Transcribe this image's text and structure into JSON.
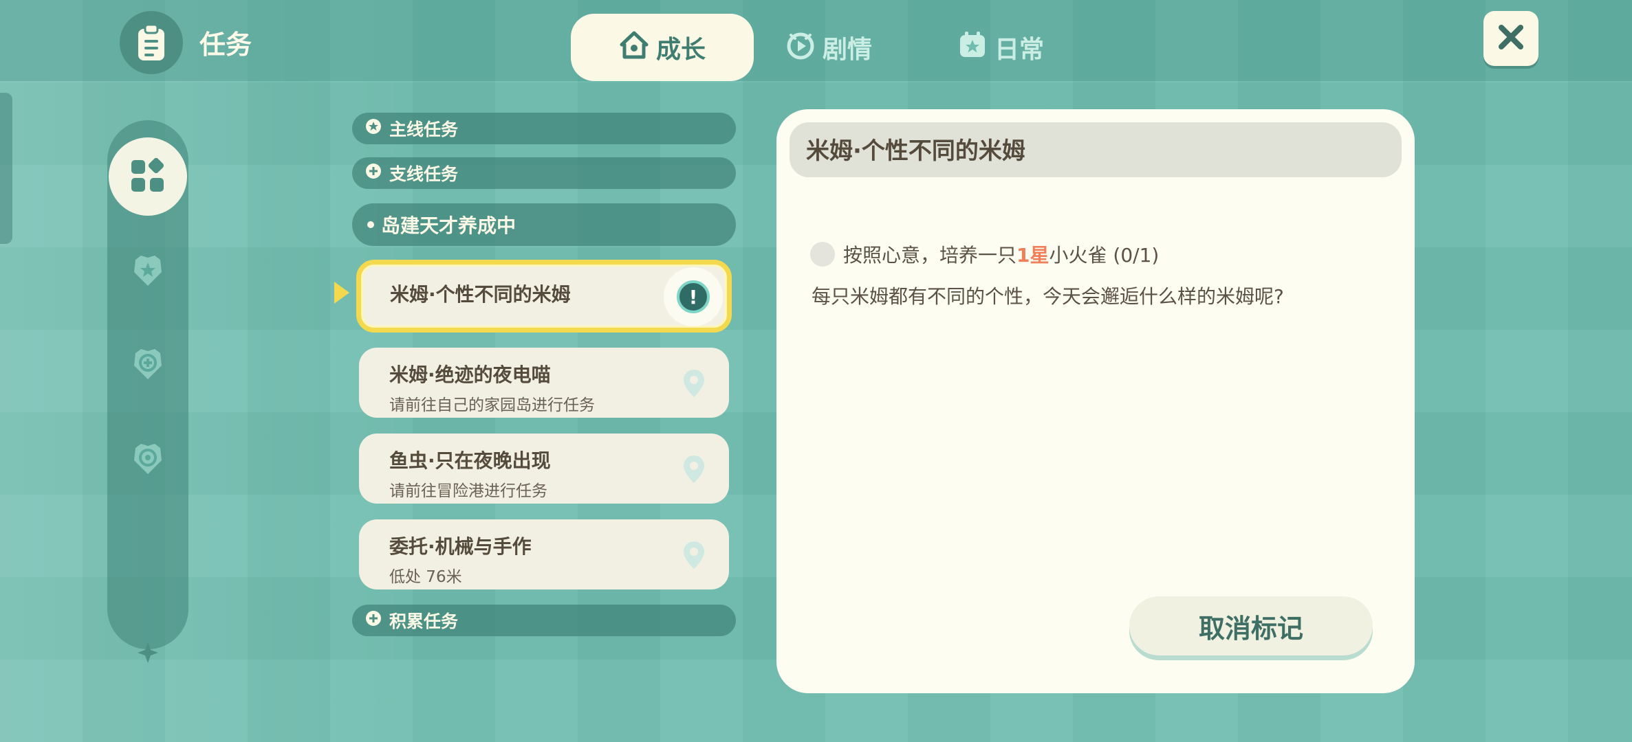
{
  "header": {
    "title": "任务",
    "tabs": [
      {
        "label": "成长",
        "icon": "home-icon",
        "active": true
      },
      {
        "label": "剧情",
        "icon": "play-icon",
        "active": false
      },
      {
        "label": "日常",
        "icon": "calendar-star-icon",
        "active": false
      }
    ]
  },
  "sidebar": {
    "items": [
      {
        "icon": "grid-icon",
        "active": true
      },
      {
        "icon": "star-badge-icon",
        "active": false
      },
      {
        "icon": "plus-badge-icon",
        "active": false
      },
      {
        "icon": "target-badge-icon",
        "active": false
      }
    ]
  },
  "quests": {
    "main_label": "主线任务",
    "side_label": "支线任务",
    "sub_group_label": "岛建天才养成中",
    "accum_label": "积累任务",
    "items": [
      {
        "name": "米姆·个性不同的米姆",
        "location": "",
        "selected": true
      },
      {
        "name": "米姆·绝迹的夜电喵",
        "location": "请前往自己的家园岛进行任务",
        "selected": false
      },
      {
        "name": "鱼虫·只在夜晚出现",
        "location": "请前往冒险港进行任务",
        "selected": false
      },
      {
        "name": "委托·机械与手作",
        "location": "低处 76米",
        "selected": false
      }
    ]
  },
  "detail": {
    "title": "米姆·个性不同的米姆",
    "objective_prefix": "按照心意，培养一只",
    "objective_highlight": "1星",
    "objective_suffix": "小火雀 (0/1)",
    "description": "每只米姆都有不同的个性，今天会邂逅什么样的米姆呢?",
    "button_label": "取消标记"
  },
  "colors": {
    "accent_yellow": "#f4d94f",
    "highlight_orange": "#f0805a",
    "panel_bg": "#fdfdf1",
    "teal_dark": "#3f7d70"
  }
}
